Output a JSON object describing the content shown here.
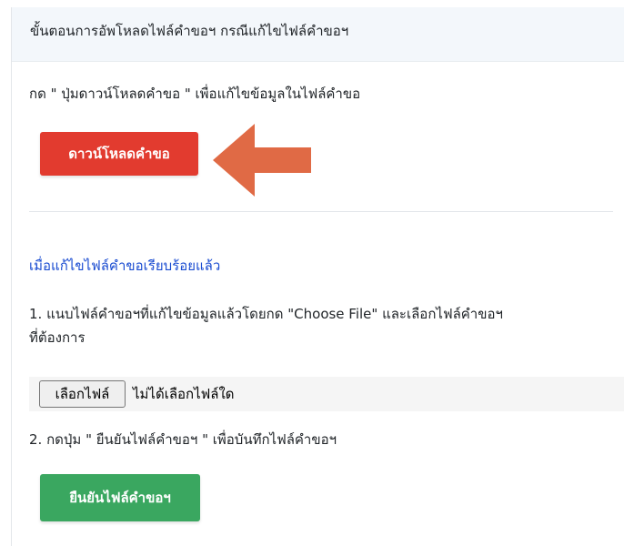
{
  "header": {
    "title": "ขั้นตอนการอัพโหลดไฟล์คำขอฯ กรณีแก้ไขไฟล์คำขอฯ"
  },
  "download_section": {
    "instruction": "กด \" ปุ่มดาวน์โหลดคำขอ \" เพื่อแก้ไขข้อมูลในไฟล์คำขอ",
    "download_button_label": "ดาวน์โหลดคำขอ",
    "arrow_icon": "arrow-left-icon"
  },
  "upload_section": {
    "heading": "เมื่อแก้ไขไฟล์คำขอเรียบร้อยแล้ว",
    "step1_line1": "1. แนบไฟล์คำขอฯที่แก้ไขข้อมูลแล้วโดยกด \"Choose File\" และเลือกไฟล์คำขอฯ",
    "step1_line2": "ที่ต้องการ",
    "file_button_label": "เลือกไฟล์",
    "file_status": "ไม่ได้เลือกไฟล์ใด",
    "step2": "2. กดปุ่ม \" ยืนยันไฟล์คำขอฯ \" เพื่อบันทึกไฟล์คำขอฯ",
    "confirm_button_label": "ยืนยันไฟล์คำขอฯ"
  },
  "colors": {
    "download_button": "#e23b2f",
    "confirm_button": "#3aa760",
    "arrow": "#e06a45",
    "heading_link": "#1a4cd1",
    "header_bg": "#f3f7fb"
  }
}
